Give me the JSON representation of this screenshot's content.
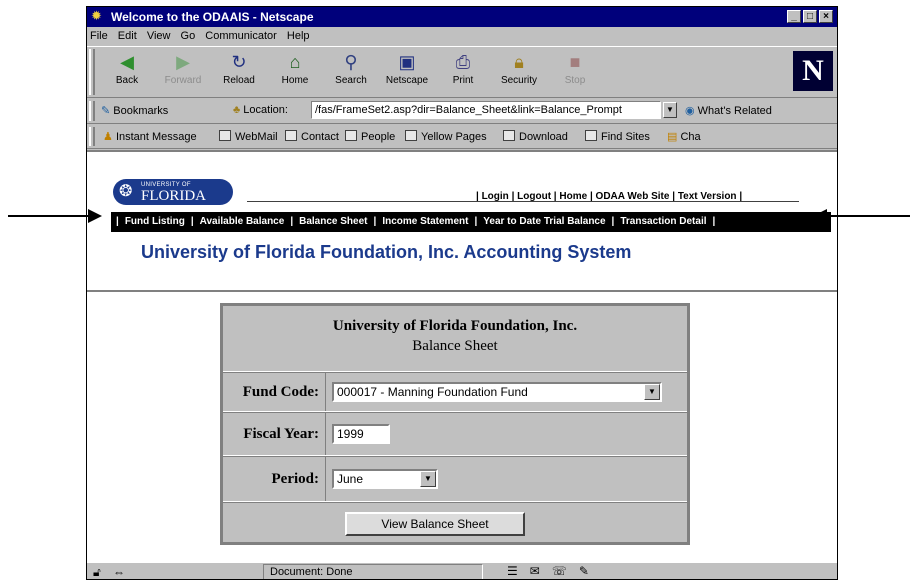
{
  "window": {
    "title": "Welcome to the ODAAIS - Netscape",
    "min": "_",
    "max": "□",
    "close": "×"
  },
  "menu": [
    "File",
    "Edit",
    "View",
    "Go",
    "Communicator",
    "Help"
  ],
  "toolbar": {
    "back": "Back",
    "forward": "Forward",
    "reload": "Reload",
    "home": "Home",
    "search": "Search",
    "netscape": "Netscape",
    "print": "Print",
    "security": "Security",
    "stop": "Stop",
    "logo": "N"
  },
  "location": {
    "bookmarks": "Bookmarks",
    "label": "Location:",
    "url": "/fas/FrameSet2.asp?dir=Balance_Sheet&link=Balance_Prompt",
    "related": "What's Related"
  },
  "personal": [
    "Instant Message",
    "WebMail",
    "Contact",
    "People",
    "Yellow Pages",
    "Download",
    "Find Sites",
    "Cha"
  ],
  "header": {
    "logo_small": "UNIVERSITY OF",
    "logo_big": "FLORIDA",
    "top_links": [
      "Login",
      "Logout",
      "Home",
      "ODAA Web Site",
      "Text Version"
    ],
    "nav": [
      "Fund Listing",
      "Available Balance",
      "Balance Sheet",
      "Income Statement",
      "Year to Date Trial Balance",
      "Transaction Detail"
    ],
    "system_title": "University of Florida Foundation, Inc. Accounting System"
  },
  "form": {
    "heading": "University of Florida Foundation, Inc.",
    "subheading": "Balance Sheet",
    "fund_label": "Fund Code:",
    "fund_value": "000017 - Manning Foundation Fund",
    "year_label": "Fiscal Year:",
    "year_value": "1999",
    "period_label": "Period:",
    "period_value": "June",
    "submit": "View Balance Sheet"
  },
  "status": {
    "text": "Document: Done"
  }
}
